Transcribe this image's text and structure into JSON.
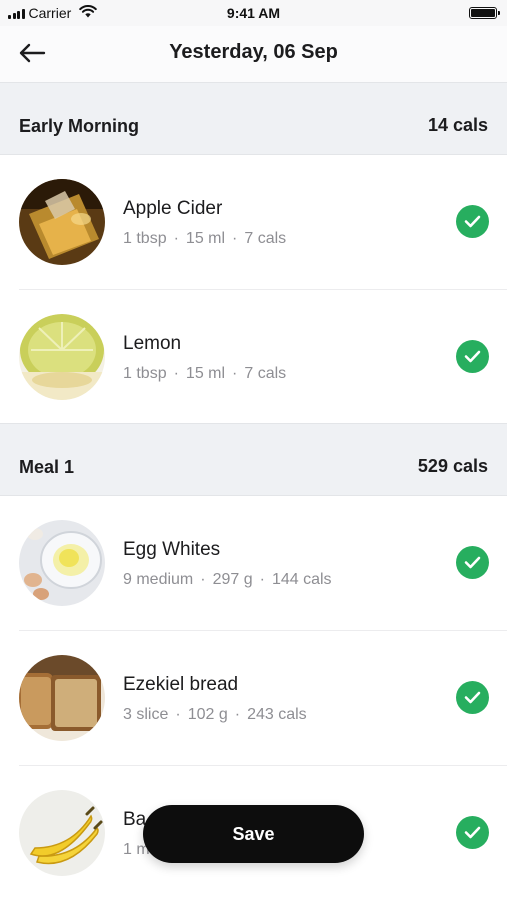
{
  "status_bar": {
    "carrier": "Carrier",
    "time": "9:41 AM",
    "icons": [
      "signal-icon",
      "wifi-icon",
      "battery-icon"
    ]
  },
  "header": {
    "back_icon": "arrow-left-icon",
    "title": "Yesterday, 06 Sep"
  },
  "sections": [
    {
      "name": "Early Morning",
      "cals": "14 cals",
      "items": [
        {
          "name": "Apple Cider",
          "qty": "1 tbsp",
          "weight": "15 ml",
          "cals": "7 cals",
          "checked": true
        },
        {
          "name": "Lemon",
          "qty": "1 tbsp",
          "weight": "15 ml",
          "cals": "7 cals",
          "checked": true
        }
      ]
    },
    {
      "name": "Meal 1",
      "cals": "529 cals",
      "items": [
        {
          "name": "Egg Whites",
          "qty": "9 medium",
          "weight": "297 g",
          "cals": "144 cals",
          "checked": true
        },
        {
          "name": "Ezekiel bread",
          "qty": "3 slice",
          "weight": "102 g",
          "cals": "243 cals",
          "checked": true
        },
        {
          "name": "Ba",
          "qty": "1 m",
          "checked": true
        }
      ]
    }
  ],
  "save_button": {
    "label": "Save"
  },
  "colors": {
    "check": "#27ae5f",
    "section_bg": "#eff1f4",
    "meta_text": "#8e8e93",
    "button_bg": "#0d0d0d"
  }
}
